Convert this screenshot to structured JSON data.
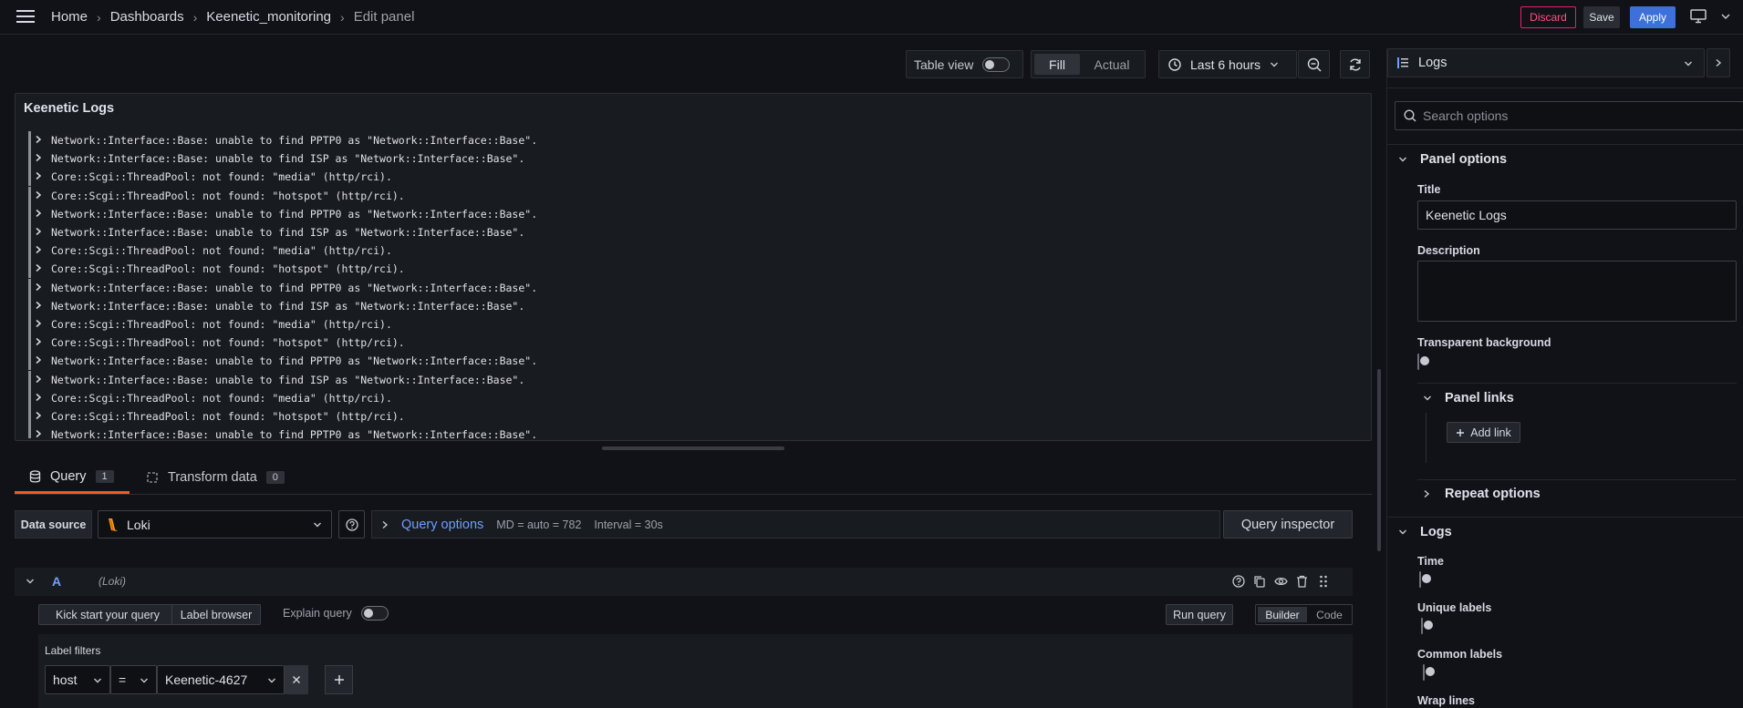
{
  "breadcrumbs": [
    "Home",
    "Dashboards",
    "Keenetic_monitoring",
    "Edit panel"
  ],
  "actions": {
    "discard": "Discard",
    "save": "Save",
    "apply": "Apply"
  },
  "toolbar": {
    "table_view": "Table view",
    "fill": "Fill",
    "actual": "Actual",
    "time_range": "Last 6 hours"
  },
  "panel": {
    "title": "Keenetic Logs",
    "lines": [
      "Network::Interface::Base: unable to find PPTP0 as \"Network::Interface::Base\".",
      "Network::Interface::Base: unable to find ISP as \"Network::Interface::Base\".",
      "Core::Scgi::ThreadPool: not found: \"media\" (http/rci).",
      "Core::Scgi::ThreadPool: not found: \"hotspot\" (http/rci).",
      "Network::Interface::Base: unable to find PPTP0 as \"Network::Interface::Base\".",
      "Network::Interface::Base: unable to find ISP as \"Network::Interface::Base\".",
      "Core::Scgi::ThreadPool: not found: \"media\" (http/rci).",
      "Core::Scgi::ThreadPool: not found: \"hotspot\" (http/rci).",
      "Network::Interface::Base: unable to find PPTP0 as \"Network::Interface::Base\".",
      "Network::Interface::Base: unable to find ISP as \"Network::Interface::Base\".",
      "Core::Scgi::ThreadPool: not found: \"media\" (http/rci).",
      "Core::Scgi::ThreadPool: not found: \"hotspot\" (http/rci).",
      "Network::Interface::Base: unable to find PPTP0 as \"Network::Interface::Base\".",
      "Network::Interface::Base: unable to find ISP as \"Network::Interface::Base\".",
      "Core::Scgi::ThreadPool: not found: \"media\" (http/rci).",
      "Core::Scgi::ThreadPool: not found: \"hotspot\" (http/rci).",
      "Network::Interface::Base: unable to find PPTP0 as \"Network::Interface::Base\"."
    ]
  },
  "tabs": [
    {
      "label": "Query",
      "count": "1"
    },
    {
      "label": "Transform data",
      "count": "0"
    }
  ],
  "query": {
    "data_source_label": "Data source",
    "data_source": "Loki",
    "query_options": "Query options",
    "md": "MD = auto = 782",
    "interval": "Interval = 30s",
    "inspector": "Query inspector",
    "ref_id": "A",
    "ref_source": "(Loki)",
    "kick_start": "Kick start your query",
    "label_browser": "Label browser",
    "explain": "Explain query",
    "run": "Run query",
    "builder": "Builder",
    "code": "Code",
    "label_filters": "Label filters",
    "filter_key": "host",
    "filter_op": "=",
    "filter_value": "Keenetic-4627"
  },
  "options": {
    "viz": "Logs",
    "search_placeholder": "Search options",
    "panel_options": "Panel options",
    "title_label": "Title",
    "title_value": "Keenetic Logs",
    "description_label": "Description",
    "transparent_label": "Transparent background",
    "panel_links": "Panel links",
    "add_link": "Add link",
    "repeat_options": "Repeat options",
    "logs_section": "Logs",
    "time": "Time",
    "unique_labels": "Unique labels",
    "common_labels": "Common labels",
    "wrap_lines": "Wrap lines"
  },
  "colors": {
    "accent": "#3d71d9",
    "discard": "#e0226e",
    "query_tab": "#f05a28",
    "link": "#6e9fff"
  }
}
